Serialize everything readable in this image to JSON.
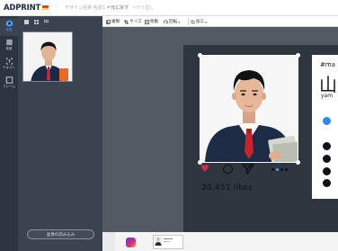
{
  "app": {
    "logo_text": "ADPRINT",
    "logo_colors": [
      "#e53935",
      "#1e88e5",
      "#fdd835"
    ],
    "doc_title": "デザイン名称 名前1",
    "undo_label": "↶元に戻す",
    "redo_label": "↷やり直し"
  },
  "rail": {
    "items": [
      {
        "label": "写真",
        "icon": "photo-icon",
        "active": true
      },
      {
        "label": "背景",
        "icon": "background-icon",
        "active": false
      },
      {
        "label": "テキスト",
        "icon": "text-icon",
        "active": false
      },
      {
        "label": "フレーム",
        "icon": "frame-icon",
        "active": false
      }
    ]
  },
  "panel": {
    "upload_label": "画像の読み込み"
  },
  "toolbar": {
    "items": [
      {
        "label": "複製",
        "icon": "duplicate-icon"
      },
      {
        "label": "サイズ",
        "icon": "crop-icon"
      },
      {
        "label": "移動",
        "icon": "move-icon"
      },
      {
        "label": "回転",
        "icon": "rotate-icon"
      },
      {
        "label": "加工",
        "icon": "adjust-icon"
      }
    ]
  },
  "post": {
    "likes": "20,451 likes",
    "hashtag": "#ma",
    "name_big": "山",
    "name_small": "yam"
  },
  "colors": {
    "rail_bg": "#2d3340",
    "panel_bg": "#3c4350",
    "canvas_bg": "#545a63",
    "accent": "#4aa3ff",
    "heart": "#c8324a"
  }
}
